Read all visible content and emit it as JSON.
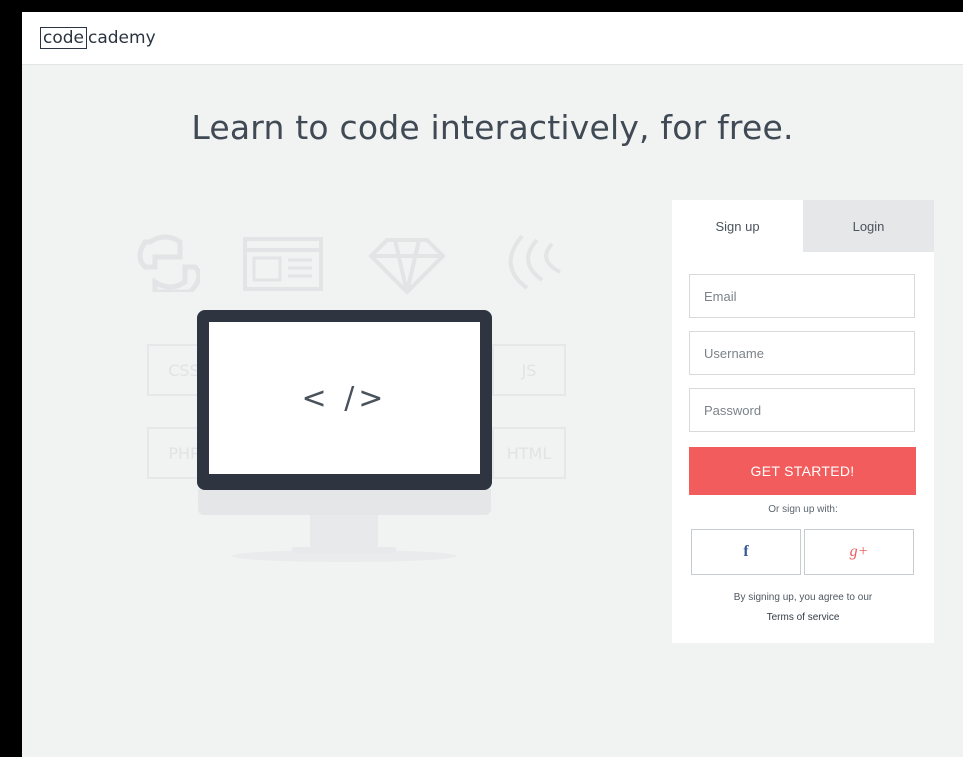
{
  "header": {
    "logo_part1": "code",
    "logo_part2": "cademy"
  },
  "hero": {
    "headline": "Learn to code interactively, for free."
  },
  "illustration": {
    "screen_text": "< />",
    "bg_labels": [
      "CSS",
      "JS",
      "PHP",
      "HTML"
    ]
  },
  "signup": {
    "tabs": [
      {
        "label": "Sign up",
        "active": true
      },
      {
        "label": "Login",
        "active": false
      }
    ],
    "email_placeholder": "Email",
    "username_placeholder": "Username",
    "password_placeholder": "Password",
    "cta_label": "GET STARTED!",
    "or_text": "Or sign up with:",
    "social": [
      {
        "icon": "facebook-icon",
        "glyph": "f"
      },
      {
        "icon": "google-plus-icon",
        "glyph": "g+"
      }
    ],
    "terms_text": "By signing up, you agree to our",
    "terms_link": "Terms of service"
  },
  "colors": {
    "accent": "#f25c5c",
    "page_bg": "#f1f2f2",
    "dark": "#2e3540"
  }
}
